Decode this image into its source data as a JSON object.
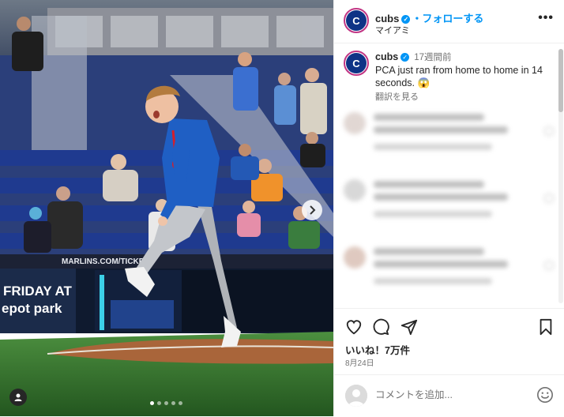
{
  "post": {
    "author": "cubs",
    "follow_label": "・フォローする",
    "location": "マイアミ",
    "more_label": "•••"
  },
  "caption": {
    "author": "cubs",
    "time": "17週間前",
    "text": "PCA just ran from home to home in 14 seconds. 😱",
    "see_translation": "翻訳を見る"
  },
  "photo": {
    "banner_line1": "FRIDAY AT",
    "banner_line2": "epot park",
    "board_text": "MARLINS.COM/TICKETS",
    "carousel_count": 5,
    "carousel_active": 0
  },
  "engagement": {
    "likes": "いいね！7万件",
    "date": "8月24日"
  },
  "comment_input": {
    "placeholder": "コメントを追加..."
  },
  "icons": [
    "heart-icon",
    "comment-icon",
    "share-icon",
    "bookmark-icon",
    "emoji-icon",
    "more-icon",
    "verified-icon",
    "user-tag-icon",
    "chevron-right-icon"
  ],
  "colors": {
    "accent": "#0095f6",
    "cubs_blue": "#0e3386",
    "text": "#262626",
    "muted": "#737373"
  }
}
